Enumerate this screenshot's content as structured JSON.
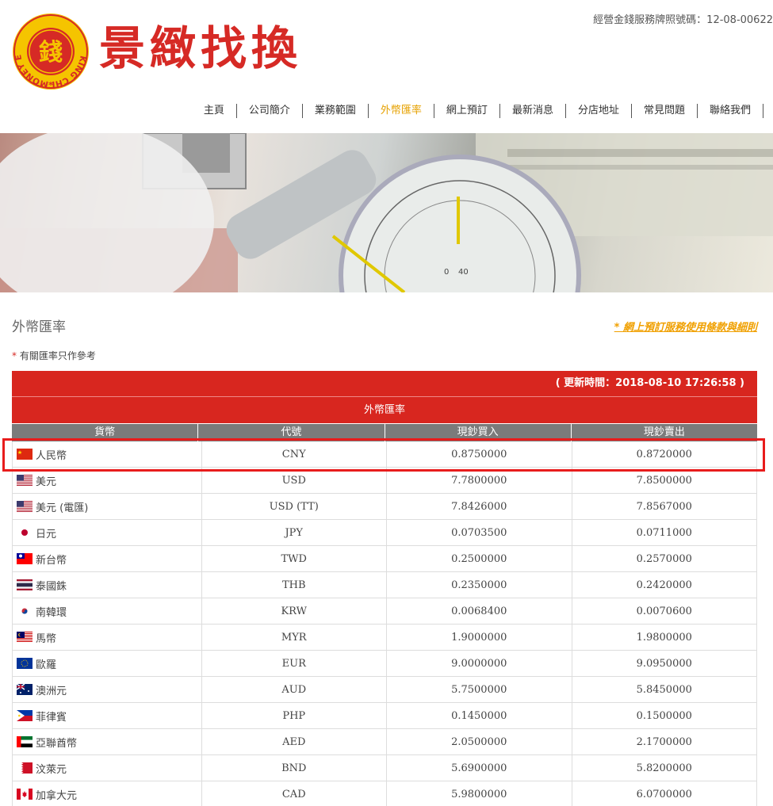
{
  "header": {
    "logo_char": "錢",
    "logo_ring_text": "KING CHI MONEY EXCHANGE",
    "logo_star": "*",
    "site_title": "景緻找換",
    "license": "經營金錢服務牌照號碼：12-08-00622"
  },
  "nav": {
    "items": [
      {
        "label": "主頁"
      },
      {
        "label": "公司簡介"
      },
      {
        "label": "業務範圍"
      },
      {
        "label": "外幣匯率"
      },
      {
        "label": "網上預訂"
      },
      {
        "label": "最新消息"
      },
      {
        "label": "分店地址"
      },
      {
        "label": "常見問題"
      },
      {
        "label": "聯絡我們"
      }
    ],
    "active": "外幣匯率"
  },
  "section": {
    "title": "外幣匯率",
    "terms_link": "* 網上預訂服務使用條款與細則",
    "note_star": "*",
    "note_text": "有關匯率只作參考"
  },
  "table": {
    "update_text": "( 更新時間：2018-08-10 17:26:58 )",
    "title": "外幣匯率",
    "headers": [
      "貨幣",
      "代號",
      "現鈔買入",
      "現鈔賣出"
    ],
    "rows": [
      {
        "flag": "cn-flag-icon",
        "name": "人民幣",
        "code": "CNY",
        "buy": "0.8750000",
        "sell": "0.8720000"
      },
      {
        "flag": "us-flag-icon",
        "name": "美元",
        "code": "USD",
        "buy": "7.7800000",
        "sell": "7.8500000"
      },
      {
        "flag": "us-flag-icon",
        "name": "美元 (電匯)",
        "code": "USD (TT)",
        "buy": "7.8426000",
        "sell": "7.8567000"
      },
      {
        "flag": "jp-flag-icon",
        "name": "日元",
        "code": "JPY",
        "buy": "0.0703500",
        "sell": "0.0711000"
      },
      {
        "flag": "tw-flag-icon",
        "name": "新台幣",
        "code": "TWD",
        "buy": "0.2500000",
        "sell": "0.2570000"
      },
      {
        "flag": "th-flag-icon",
        "name": "泰國銖",
        "code": "THB",
        "buy": "0.2350000",
        "sell": "0.2420000"
      },
      {
        "flag": "kr-flag-icon",
        "name": "南韓環",
        "code": "KRW",
        "buy": "0.0068400",
        "sell": "0.0070600"
      },
      {
        "flag": "my-flag-icon",
        "name": "馬幣",
        "code": "MYR",
        "buy": "1.9000000",
        "sell": "1.9800000"
      },
      {
        "flag": "eu-flag-icon",
        "name": "歐羅",
        "code": "EUR",
        "buy": "9.0000000",
        "sell": "9.0950000"
      },
      {
        "flag": "au-flag-icon",
        "name": "澳洲元",
        "code": "AUD",
        "buy": "5.7500000",
        "sell": "5.8450000"
      },
      {
        "flag": "ph-flag-icon",
        "name": "菲律賓",
        "code": "PHP",
        "buy": "0.1450000",
        "sell": "0.1500000"
      },
      {
        "flag": "ae-flag-icon",
        "name": "亞聯酋幣",
        "code": "AED",
        "buy": "2.0500000",
        "sell": "2.1700000"
      },
      {
        "flag": "bh-flag-icon",
        "name": "汶萊元",
        "code": "BND",
        "buy": "5.6900000",
        "sell": "5.8200000"
      },
      {
        "flag": "ca-flag-icon",
        "name": "加拿大元",
        "code": "CAD",
        "buy": "5.9800000",
        "sell": "6.0700000"
      }
    ]
  },
  "colors": {
    "brand_red": "#d8261f",
    "nav_active": "#e6a100",
    "highlight": "#e81c1c"
  }
}
